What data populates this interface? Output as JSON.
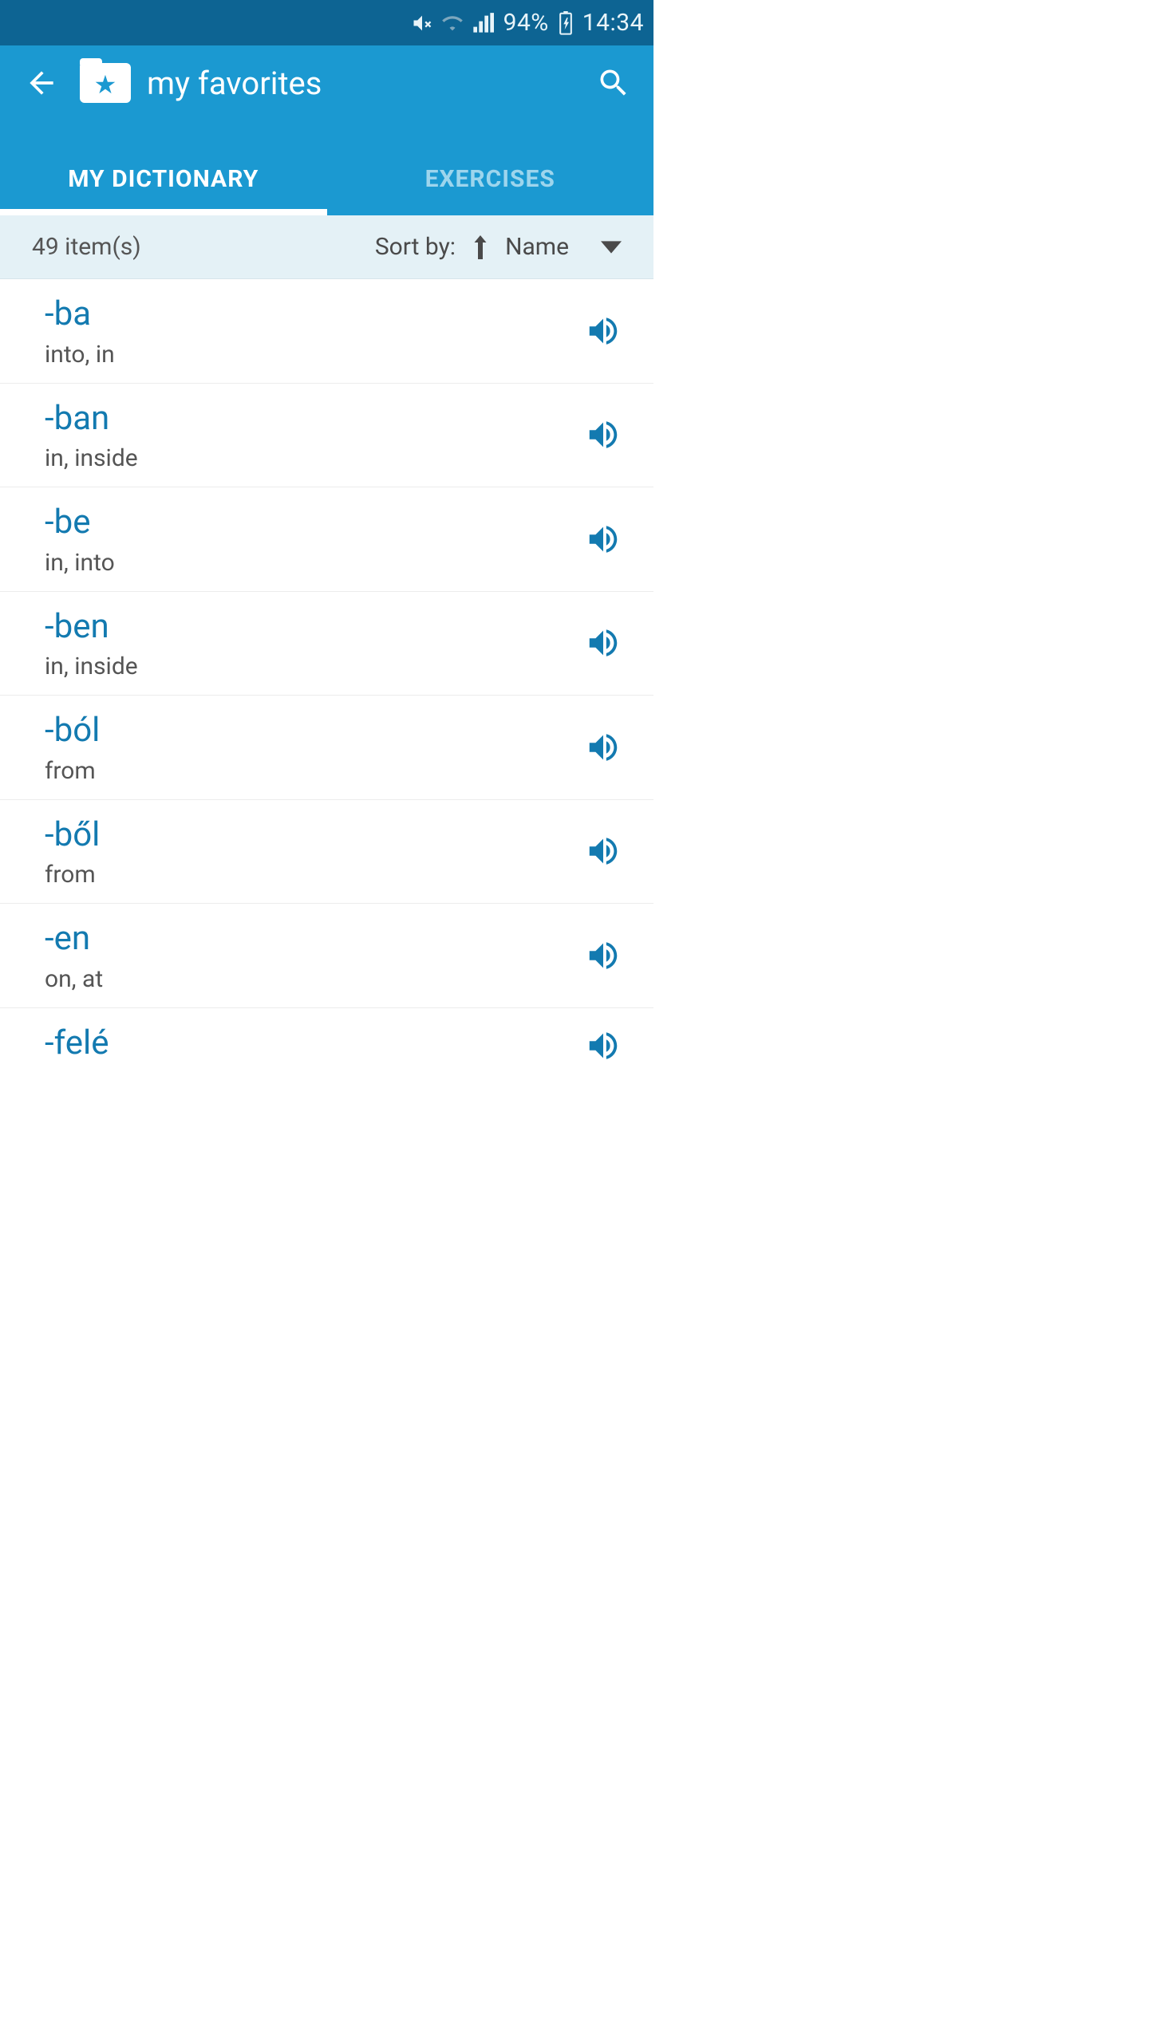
{
  "status": {
    "battery": "94%",
    "time": "14:34"
  },
  "header": {
    "title": "my favorites"
  },
  "tabs": [
    {
      "label": "MY DICTIONARY",
      "active": true
    },
    {
      "label": "EXERCISES",
      "active": false
    }
  ],
  "sort": {
    "count": "49 item(s)",
    "label": "Sort by:",
    "value": "Name"
  },
  "items": [
    {
      "word": "-ba",
      "translation": "into, in"
    },
    {
      "word": "-ban",
      "translation": "in, inside"
    },
    {
      "word": "-be",
      "translation": "in, into"
    },
    {
      "word": "-ben",
      "translation": "in, inside"
    },
    {
      "word": "-ból",
      "translation": "from"
    },
    {
      "word": "-ből",
      "translation": "from"
    },
    {
      "word": "-en",
      "translation": "on, at"
    },
    {
      "word": "-felé",
      "translation": ""
    }
  ],
  "colors": {
    "accent": "#1b99d1",
    "accentDark": "#0d6493",
    "word": "#137ab0"
  }
}
